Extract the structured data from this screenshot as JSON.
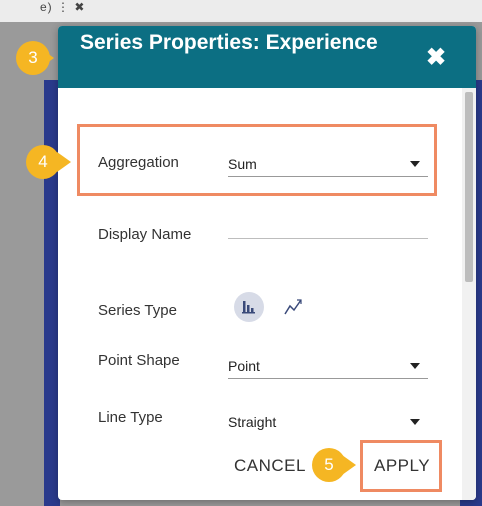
{
  "background": {
    "strip_text": "e) ⋮ ✖"
  },
  "modal": {
    "title": "Series Properties: Experience",
    "close_glyph": "✖"
  },
  "form": {
    "aggregation": {
      "label": "Aggregation",
      "value": "Sum"
    },
    "display_name": {
      "label": "Display Name",
      "value": ""
    },
    "series_type": {
      "label": "Series Type",
      "options": [
        "bar-chart-icon",
        "line-chart-icon"
      ],
      "selected": "bar-chart-icon"
    },
    "point_shape": {
      "label": "Point Shape",
      "value": "Point"
    },
    "line_type": {
      "label": "Line Type",
      "value": "Straight"
    }
  },
  "footer": {
    "cancel_label": "CANCEL",
    "apply_label": "APPLY"
  },
  "steps": {
    "s3": "3",
    "s4": "4",
    "s5": "5"
  },
  "colors": {
    "header": "#0c6f83",
    "highlight": "#ef8a62",
    "step_badge": "#f5b623"
  }
}
